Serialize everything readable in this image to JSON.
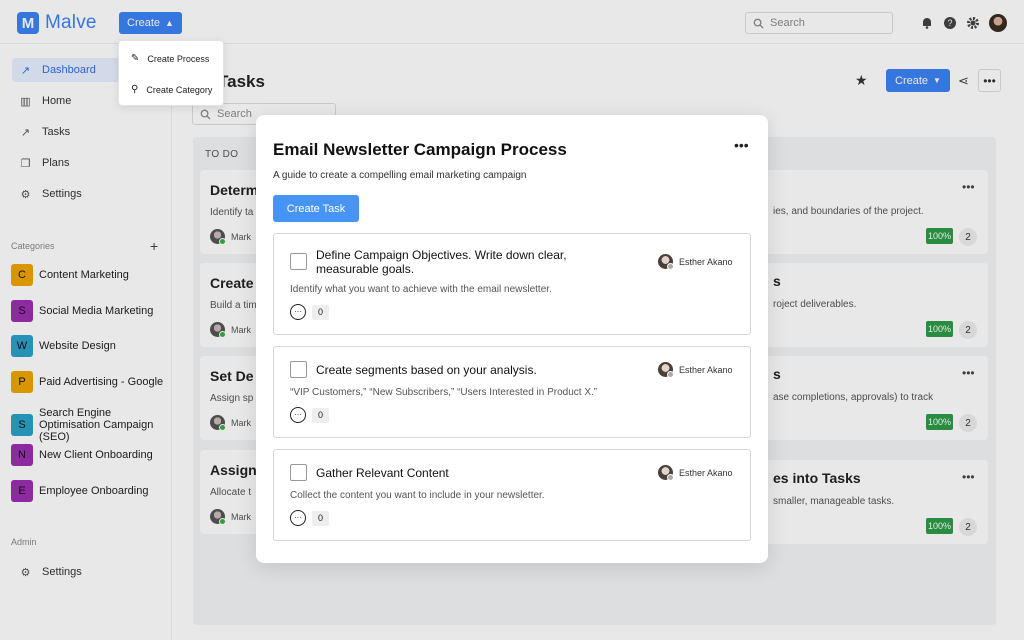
{
  "app": {
    "logo_letter": "M",
    "name": "Malve"
  },
  "topbar": {
    "create_label": "Create",
    "search_placeholder": "Search"
  },
  "create_menu": {
    "items": [
      {
        "label": "Create Process",
        "icon": "pencil-icon"
      },
      {
        "label": "Create Category",
        "icon": "pin-icon"
      }
    ]
  },
  "sidebar": {
    "nav": [
      {
        "label": "Dashboard",
        "icon": "trend-icon",
        "active": true
      },
      {
        "label": "Home",
        "icon": "columns-icon"
      },
      {
        "label": "Tasks",
        "icon": "trend-icon"
      },
      {
        "label": "Plans",
        "icon": "document-icon"
      },
      {
        "label": "Settings",
        "icon": "gear-icon"
      }
    ],
    "categories_label": "Categories",
    "categories": [
      {
        "letter": "C",
        "label": "Content Marketing",
        "color": "#f0a500"
      },
      {
        "letter": "S",
        "label": "Social Media Marketing",
        "color": "#9b2fb0"
      },
      {
        "letter": "W",
        "label": "Website Design",
        "color": "#2aa2c8"
      },
      {
        "letter": "P",
        "label": "Paid Advertising - Google",
        "color": "#f0a500"
      },
      {
        "letter": "S",
        "label": "Search Engine Optimisation Campaign (SEO)",
        "color": "#2aa2c8"
      },
      {
        "letter": "N",
        "label": "New Client Onboarding",
        "color": "#9b2fb0"
      },
      {
        "letter": "E",
        "label": "Employee Onboarding",
        "color": "#9b2fb0"
      }
    ],
    "admin_label": "Admin",
    "admin_settings": "Settings"
  },
  "main": {
    "title": "Tasks",
    "create_label": "Create",
    "search_placeholder": "Search",
    "column_todo": "TO DO",
    "left_cards": [
      {
        "title": "Determ",
        "desc": "Identify ta",
        "user": "Mark"
      },
      {
        "title": "Create",
        "desc": "Build a tim",
        "user": "Mark"
      },
      {
        "title": "Set De",
        "desc": "Assign sp",
        "user": "Mark"
      },
      {
        "title": "Assign",
        "desc": "Allocate t",
        "user": "Mark"
      }
    ],
    "right_cards": [
      {
        "title": "",
        "desc": "ies, and boundaries of the project.",
        "pct": "100%",
        "count": "2"
      },
      {
        "title": "s",
        "desc": "roject deliverables.",
        "pct": "100%",
        "count": "2"
      },
      {
        "title": "s",
        "desc": "ase completions, approvals) to track",
        "pct": "100%",
        "count": "2"
      },
      {
        "title": "es into Tasks",
        "desc": "smaller, manageable tasks.",
        "pct": "100%",
        "count": "2"
      }
    ]
  },
  "modal": {
    "title": "Email Newsletter Campaign Process",
    "subtitle": "A guide to create a compelling email marketing campaign",
    "create_task_label": "Create Task",
    "tasks": [
      {
        "title": "Define Campaign Objectives. Write down clear, measurable goals.",
        "assignee": "Esther Akano",
        "desc": "Identify what you want to achieve with the email newsletter.",
        "comments": "0"
      },
      {
        "title": "Create segments based on your analysis.",
        "assignee": "Esther Akano",
        "desc": "“VIP Customers,” “New Subscribers,” “Users Interested in Product X.”",
        "comments": "0"
      },
      {
        "title": "Gather Relevant Content",
        "assignee": "Esther Akano",
        "desc": "Collect the content you want to include in your newsletter.",
        "comments": "0"
      }
    ]
  }
}
